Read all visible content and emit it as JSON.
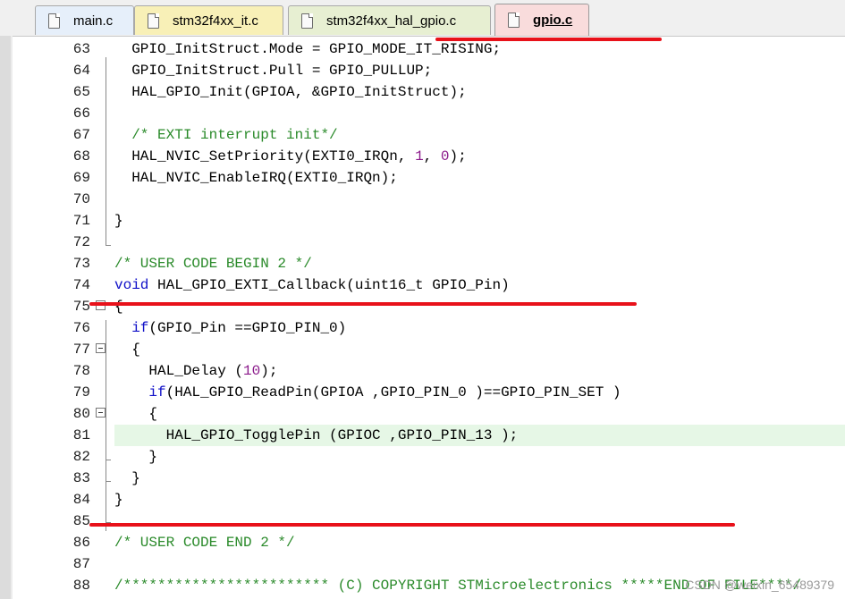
{
  "tabs": [
    {
      "label": "main.c",
      "icon": "c-file-icon",
      "active": false
    },
    {
      "label": "stm32f4xx_it.c",
      "icon": "c-file-icon",
      "active": false
    },
    {
      "label": "stm32f4xx_hal_gpio.c",
      "icon": "c-file-icon",
      "active": false
    },
    {
      "label": "gpio.c",
      "icon": "c-file-icon",
      "active": true
    }
  ],
  "code_lines": [
    {
      "number": "63",
      "text": "  GPIO_InitStruct.Mode = GPIO_MODE_IT_RISING;"
    },
    {
      "number": "64",
      "text": "  GPIO_InitStruct.Pull = GPIO_PULLUP;"
    },
    {
      "number": "65",
      "text": "  HAL_GPIO_Init(GPIOA, &GPIO_InitStruct);"
    },
    {
      "number": "66",
      "text": ""
    },
    {
      "number": "67",
      "text": "  /* EXTI interrupt init*/"
    },
    {
      "number": "68",
      "text": "  HAL_NVIC_SetPriority(EXTI0_IRQn, 1, 0);"
    },
    {
      "number": "69",
      "text": "  HAL_NVIC_EnableIRQ(EXTI0_IRQn);"
    },
    {
      "number": "70",
      "text": ""
    },
    {
      "number": "71",
      "text": "}"
    },
    {
      "number": "72",
      "text": ""
    },
    {
      "number": "73",
      "text": "/* USER CODE BEGIN 2 */"
    },
    {
      "number": "74",
      "text": "void HAL_GPIO_EXTI_Callback(uint16_t GPIO_Pin)"
    },
    {
      "number": "75",
      "text": "{"
    },
    {
      "number": "76",
      "text": "  if(GPIO_Pin ==GPIO_PIN_0)"
    },
    {
      "number": "77",
      "text": "  {"
    },
    {
      "number": "78",
      "text": "    HAL_Delay (10);"
    },
    {
      "number": "79",
      "text": "    if(HAL_GPIO_ReadPin(GPIOA ,GPIO_PIN_0 )==GPIO_PIN_SET )"
    },
    {
      "number": "80",
      "text": "    {"
    },
    {
      "number": "81",
      "text": "      HAL_GPIO_TogglePin (GPIOC ,GPIO_PIN_13 );"
    },
    {
      "number": "82",
      "text": "    }"
    },
    {
      "number": "83",
      "text": "  }"
    },
    {
      "number": "84",
      "text": "}"
    },
    {
      "number": "85",
      "text": ""
    },
    {
      "number": "86",
      "text": "/* USER CODE END 2 */"
    },
    {
      "number": "87",
      "text": ""
    },
    {
      "number": "88",
      "text": "/************************ (C) COPYRIGHT STMicroelectronics *****END OF FILE****/"
    }
  ],
  "highlighted_line": "81",
  "watermark": "CSDN @weixin_65489379",
  "colors": {
    "comment": "#2a8a2a",
    "keyword": "#1010c8",
    "number": "#8b1a8b",
    "annotation": "#e8111a",
    "highlight": "#e6f7e6"
  }
}
